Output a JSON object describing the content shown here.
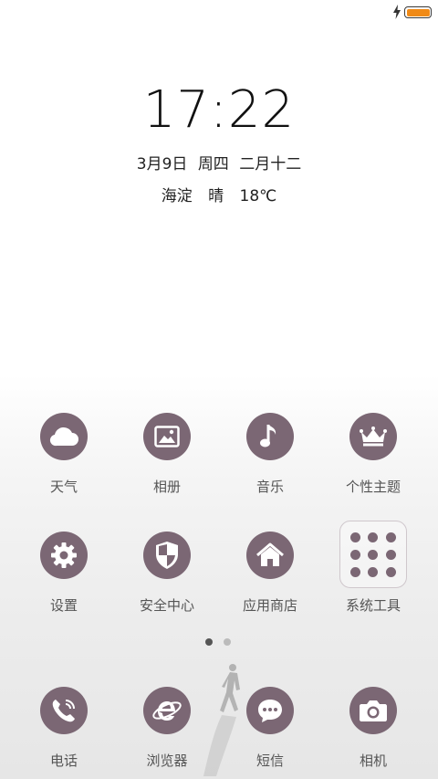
{
  "status_bar": {
    "battery_level": 1.0,
    "charging_icon": "bolt-icon",
    "battery_color": "#f08a16"
  },
  "lockscreen": {
    "time": "17:22",
    "date": "3月9日",
    "weekday": "周四",
    "lunar_date": "二月十二",
    "location": "海淀",
    "weather": "晴",
    "temperature": "18℃"
  },
  "apps": {
    "weather": {
      "label": "天气",
      "icon": "cloud-icon"
    },
    "gallery": {
      "label": "相册",
      "icon": "picture-icon"
    },
    "music": {
      "label": "音乐",
      "icon": "music-note-icon"
    },
    "themes": {
      "label": "个性主题",
      "icon": "crown-icon"
    },
    "settings": {
      "label": "设置",
      "icon": "gear-icon"
    },
    "security": {
      "label": "安全中心",
      "icon": "shield-icon"
    },
    "app_store": {
      "label": "应用商店",
      "icon": "home-icon"
    },
    "system_tools": {
      "label": "系统工具",
      "icon": "folder-icon"
    }
  },
  "dock": {
    "phone": {
      "label": "电话",
      "icon": "phone-icon"
    },
    "browser": {
      "label": "浏览器",
      "icon": "browser-e-icon"
    },
    "messages": {
      "label": "短信",
      "icon": "chat-bubble-icon"
    },
    "camera": {
      "label": "相机",
      "icon": "camera-icon"
    }
  },
  "page_indicator": {
    "pages": 2,
    "current": 1,
    "active_color": "#555555",
    "inactive_color": "#bbbbbb"
  },
  "theme": {
    "icon_color": "#7b6774",
    "label_color": "#555555"
  }
}
